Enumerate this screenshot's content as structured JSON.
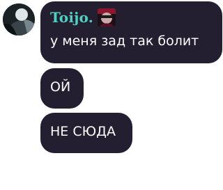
{
  "sender": {
    "name": "Toijo.",
    "name_color": "#4fd1c1",
    "avatar_icon": "user-avatar-icon",
    "badge_icon": "user-badge-icon"
  },
  "messages": [
    {
      "text": "у меня зад так болит"
    },
    {
      "text": "ОЙ"
    },
    {
      "text": "НЕ СЮДА"
    }
  ],
  "colors": {
    "bubble_background": "#231f31",
    "message_text": "#ffffff",
    "page_background": "#ffffff"
  }
}
